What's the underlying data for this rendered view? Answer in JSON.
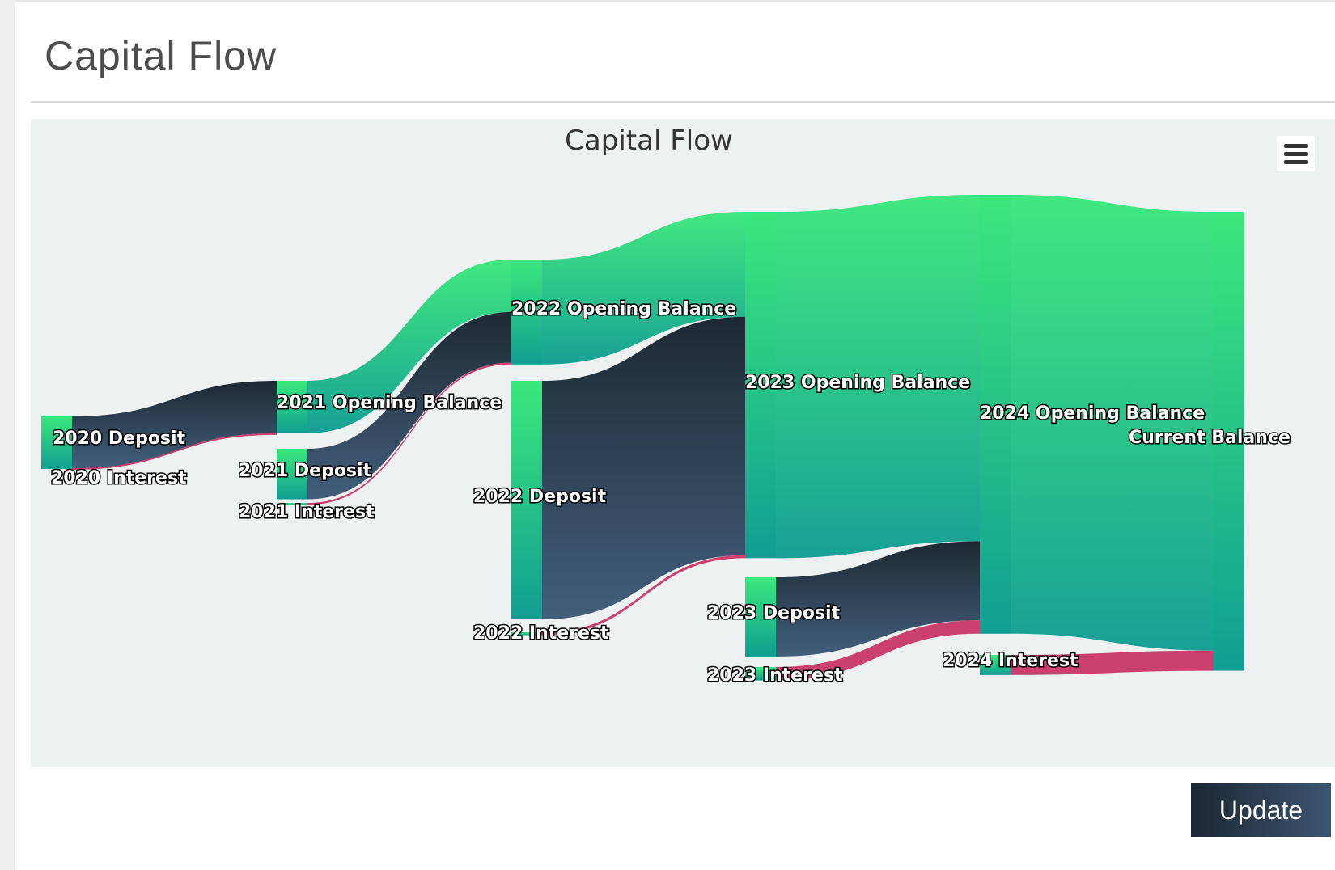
{
  "page": {
    "title": "Capital Flow"
  },
  "update_button": {
    "label": "Update"
  },
  "colors": {
    "node_top": "#3be87c",
    "node_bottom": "#119e92",
    "link_dark_top": "#16232c",
    "link_dark_bottom": "#3d5a78",
    "interest": "#c83a6a",
    "background": "#eef1f2",
    "button_dark": "#1b2733"
  },
  "chart_data": {
    "type": "sankey",
    "title": "Capital Flow",
    "nodes": [
      "2020 Deposit",
      "2020 Interest",
      "2021 Opening Balance",
      "2021 Deposit",
      "2021 Interest",
      "2022 Opening Balance",
      "2022 Deposit",
      "2022 Interest",
      "2023 Opening Balance",
      "2023 Deposit",
      "2023 Interest",
      "2024 Opening Balance",
      "2024 Interest",
      "Current Balance"
    ],
    "links": [
      {
        "from": "2020 Deposit",
        "to": "2021 Opening Balance",
        "value": 5.5
      },
      {
        "from": "2020 Interest",
        "to": "2021 Opening Balance",
        "value": 0
      },
      {
        "from": "2021 Opening Balance",
        "to": "2022 Opening Balance",
        "value": 5.5
      },
      {
        "from": "2021 Deposit",
        "to": "2022 Opening Balance",
        "value": 5.3
      },
      {
        "from": "2021 Interest",
        "to": "2022 Opening Balance",
        "value": 0.2
      },
      {
        "from": "2022 Opening Balance",
        "to": "2023 Opening Balance",
        "value": 11
      },
      {
        "from": "2022 Deposit",
        "to": "2023 Opening Balance",
        "value": 25
      },
      {
        "from": "2022 Interest",
        "to": "2023 Opening Balance",
        "value": 0.3
      },
      {
        "from": "2023 Opening Balance",
        "to": "2024 Opening Balance",
        "value": 36.3
      },
      {
        "from": "2023 Deposit",
        "to": "2024 Opening Balance",
        "value": 8.3
      },
      {
        "from": "2023 Interest",
        "to": "2024 Opening Balance",
        "value": 1.4
      },
      {
        "from": "2024 Opening Balance",
        "to": "Current Balance",
        "value": 46
      },
      {
        "from": "2024 Interest",
        "to": "Current Balance",
        "value": 2.1
      }
    ]
  }
}
